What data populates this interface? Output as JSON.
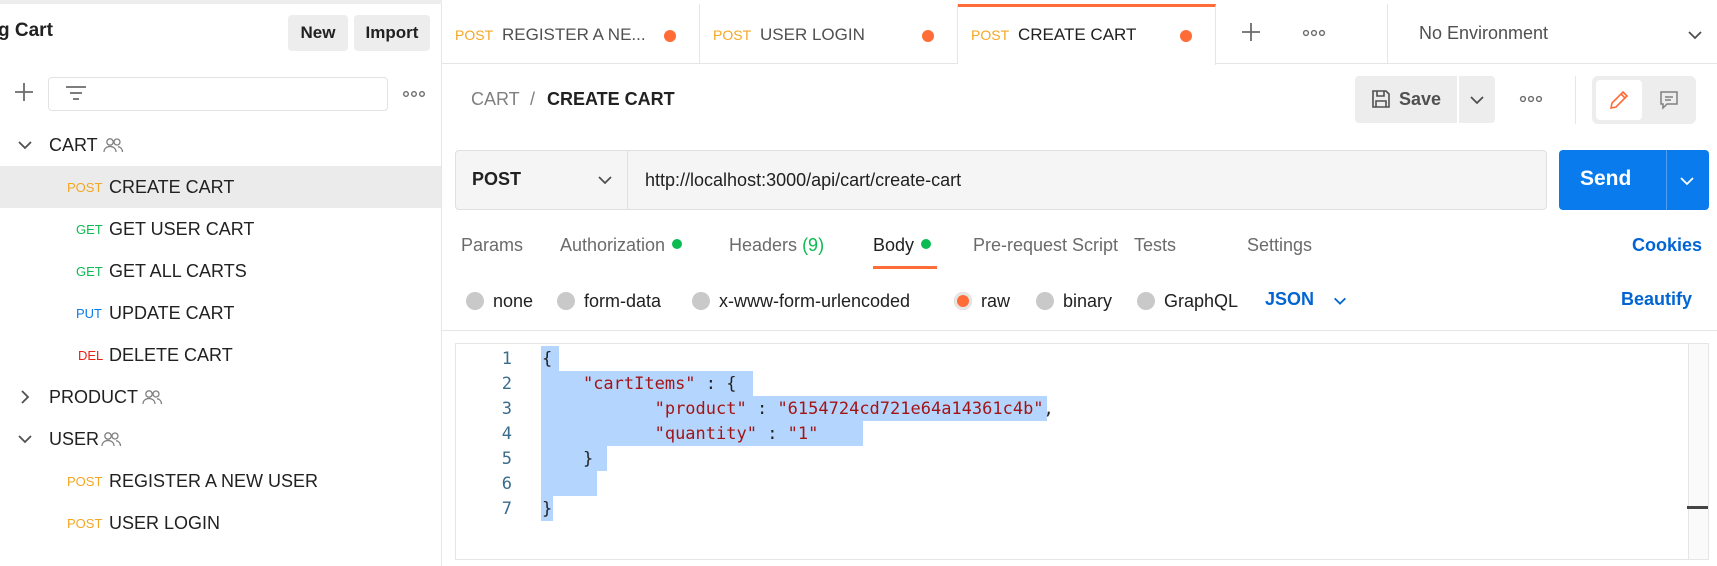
{
  "sidebar": {
    "workspace_title": "g Cart",
    "new_label": "New",
    "import_label": "Import",
    "tree": [
      {
        "type": "folder",
        "label": "CART",
        "expanded": true
      },
      {
        "type": "request",
        "method": "POST",
        "label": "CREATE CART",
        "selected": true
      },
      {
        "type": "request",
        "method": "GET",
        "label": "GET USER CART"
      },
      {
        "type": "request",
        "method": "GET",
        "label": "GET ALL CARTS"
      },
      {
        "type": "request",
        "method": "PUT",
        "label": "UPDATE CART"
      },
      {
        "type": "request",
        "method": "DEL",
        "label": "DELETE CART"
      },
      {
        "type": "folder",
        "label": "PRODUCT",
        "expanded": false
      },
      {
        "type": "folder",
        "label": "USER",
        "expanded": true
      },
      {
        "type": "request",
        "method": "POST",
        "label": "REGISTER A NEW USER"
      },
      {
        "type": "request",
        "method": "POST",
        "label": "USER LOGIN"
      }
    ]
  },
  "tabs": [
    {
      "method": "POST",
      "label": "REGISTER A NE...",
      "unsaved": true
    },
    {
      "method": "POST",
      "label": "USER LOGIN",
      "unsaved": true
    },
    {
      "method": "POST",
      "label": "CREATE CART",
      "unsaved": true,
      "active": true
    }
  ],
  "environment": {
    "label": "No Environment"
  },
  "breadcrumb": {
    "parent": "CART",
    "separator": "/",
    "current": "CREATE CART"
  },
  "toolbar": {
    "save_label": "Save"
  },
  "request": {
    "method": "POST",
    "url": "http://localhost:3000/api/cart/create-cart",
    "send_label": "Send"
  },
  "request_tabs": {
    "params": "Params",
    "authorization": "Authorization",
    "headers": "Headers",
    "headers_count": "(9)",
    "body": "Body",
    "pre_request": "Pre-request Script",
    "tests": "Tests",
    "settings": "Settings",
    "cookies": "Cookies"
  },
  "body_types": {
    "none": "none",
    "form_data": "form-data",
    "urlencoded": "x-www-form-urlencoded",
    "raw": "raw",
    "binary": "binary",
    "graphql": "GraphQL",
    "selected": "raw",
    "format": "JSON",
    "beautify": "Beautify"
  },
  "editor": {
    "line_numbers": [
      "1",
      "2",
      "3",
      "4",
      "5",
      "6",
      "7"
    ],
    "lines": [
      "{",
      "    \"cartItems\" : {",
      "           \"product\" : \"6154724cd721e64a14361c4b\",",
      "           \"quantity\" : \"1\"     ",
      "    }",
      "    ",
      "}"
    ]
  },
  "colors": {
    "accent": "#ff6c37",
    "send": "#097bed",
    "link": "#0265d2",
    "post": "#f5a623",
    "get": "#0cbb52",
    "put": "#097bed",
    "del": "#eb2013",
    "selection": "#b4d5fe"
  }
}
